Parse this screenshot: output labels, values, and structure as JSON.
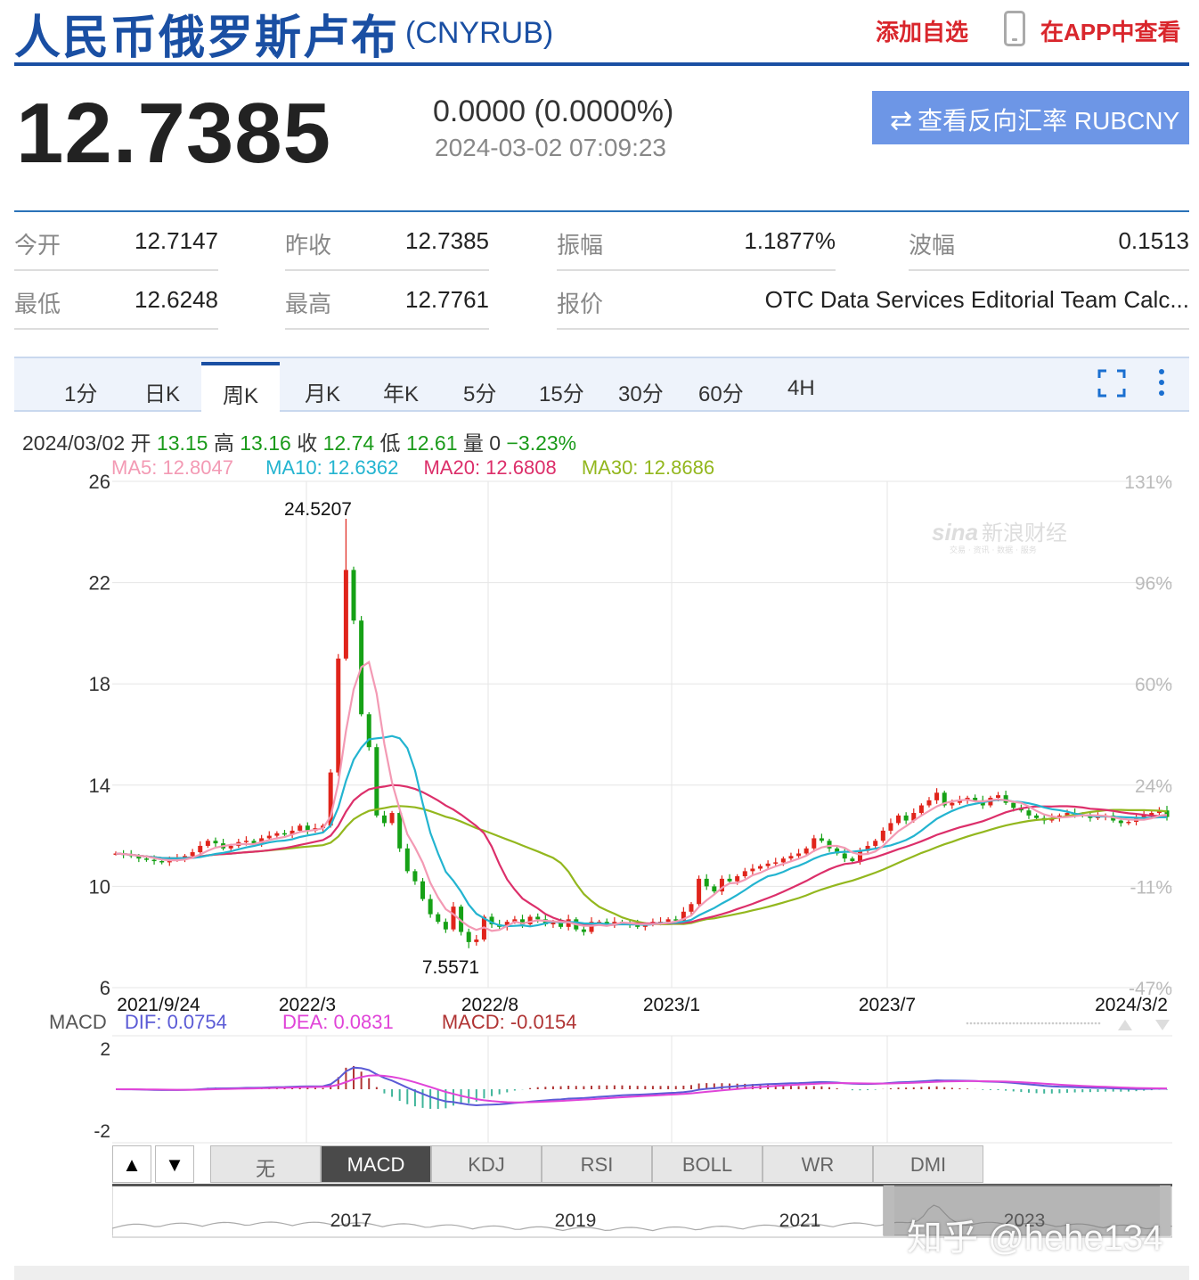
{
  "header": {
    "title": "人民币俄罗斯卢布",
    "code": "(CNYRUB)",
    "add_watchlist": "添加自选",
    "view_in_app": "在APP中查看"
  },
  "quote": {
    "price": "12.7385",
    "change": "0.0000 (0.0000%)",
    "timestamp": "2024-03-02 07:09:23",
    "reverse_icon": "⇄",
    "reverse_button": "查看反向汇率 RUBCNY"
  },
  "stats": [
    {
      "label": "今开",
      "value": "12.7147"
    },
    {
      "label": "昨收",
      "value": "12.7385"
    },
    {
      "label": "振幅",
      "value": "1.1877%"
    },
    {
      "label": "波幅",
      "value": "0.1513"
    },
    {
      "label": "最低",
      "value": "12.6248"
    },
    {
      "label": "最高",
      "value": "12.7761"
    },
    {
      "label": "报价",
      "value": "OTC Data Services Editorial Team Calc..."
    }
  ],
  "tabs": [
    "1分",
    "日K",
    "周K",
    "月K",
    "年K",
    "5分",
    "15分",
    "30分",
    "60分",
    "4H"
  ],
  "active_tab": "周K",
  "ohlc": {
    "date": "2024/03/02",
    "open_label": "开",
    "open": "13.15",
    "high_label": "高",
    "high": "13.16",
    "close_label": "收",
    "close": "12.74",
    "low_label": "低",
    "low": "12.61",
    "vol_label": "量",
    "vol": "0",
    "pct": "−3.23%"
  },
  "ma": {
    "ma5": "MA5: 12.8047",
    "ma10": "MA10: 12.6362",
    "ma20": "MA20: 12.6808",
    "ma30": "MA30: 12.8686"
  },
  "macd": {
    "label": "MACD",
    "dif": "DIF: 0.0754",
    "dea": "DEA: 0.0831",
    "macd": "MACD: -0.0154"
  },
  "indicators": [
    "无",
    "MACD",
    "KDJ",
    "RSI",
    "BOLL",
    "WR",
    "DMI"
  ],
  "active_indicator": "MACD",
  "nav": {
    "up": "▲",
    "down": "▼"
  },
  "colors": {
    "up": "#e0241b",
    "down": "#16a116",
    "ma5": "#f39ab4",
    "ma10": "#23b4d0",
    "ma20": "#dc2f6a",
    "ma30": "#93b71e",
    "dif": "#5b5bd6",
    "dea": "#e044d8",
    "brand": "#1a4fa3"
  },
  "brand_watermark": {
    "logo": "sina",
    "name": "新浪财经",
    "sub": "交易 · 资讯 · 数据 · 服务"
  },
  "overlay_watermark": "知乎 @hehe134",
  "chart_data": {
    "type": "candlestick",
    "ylim": [
      6,
      26
    ],
    "yticks": [
      6,
      10,
      14,
      18,
      22,
      26
    ],
    "pct_ticks": [
      "131%",
      "96%",
      "60%",
      "24%",
      "-11%",
      "-47%"
    ],
    "x_labels": [
      "2021/9/24",
      "2022/3",
      "2022/8",
      "2023/1",
      "2023/7",
      "2024/3/2"
    ],
    "annotations": [
      {
        "text": "24.5207",
        "value": 24.5207
      },
      {
        "text": "7.5571",
        "value": 7.5571
      }
    ],
    "close": [
      11.3,
      11.25,
      11.2,
      11.1,
      11.05,
      11.0,
      10.95,
      11.05,
      11.1,
      11.2,
      11.35,
      11.6,
      11.8,
      11.7,
      11.5,
      11.6,
      11.75,
      11.8,
      11.7,
      11.9,
      12.0,
      12.1,
      12.05,
      12.2,
      12.4,
      12.2,
      12.3,
      12.4,
      14.5,
      19.0,
      22.5,
      20.5,
      16.8,
      15.5,
      12.8,
      12.5,
      12.9,
      11.5,
      10.6,
      10.2,
      9.5,
      8.9,
      8.6,
      8.3,
      9.2,
      8.2,
      7.8,
      7.9,
      8.8,
      8.5,
      8.4,
      8.6,
      8.7,
      8.5,
      8.8,
      8.7,
      8.5,
      8.6,
      8.4,
      8.7,
      8.3,
      8.2,
      8.6,
      8.6,
      8.5,
      8.6,
      8.55,
      8.5,
      8.4,
      8.5,
      8.6,
      8.6,
      8.7,
      8.65,
      9.0,
      9.3,
      10.3,
      10.0,
      9.8,
      10.3,
      10.2,
      10.4,
      10.6,
      10.7,
      10.8,
      10.9,
      10.95,
      11.1,
      11.2,
      11.3,
      11.5,
      11.9,
      11.8,
      11.5,
      11.3,
      11.1,
      11.0,
      11.4,
      11.6,
      11.8,
      12.2,
      12.5,
      12.8,
      12.6,
      12.9,
      13.2,
      13.4,
      13.7,
      13.2,
      13.3,
      13.4,
      13.5,
      13.4,
      13.2,
      13.5,
      13.6,
      13.3,
      13.1,
      13.0,
      12.8,
      12.7,
      12.6,
      12.7,
      12.8,
      12.9,
      12.85,
      12.8,
      12.7,
      12.75,
      12.8,
      12.6,
      12.5,
      12.55,
      12.7,
      12.8,
      12.9,
      13.0,
      12.74
    ],
    "volume": [
      0
    ],
    "macd_ylim": [
      -2.6,
      2.6
    ],
    "macd_ticks": [
      2,
      -2
    ],
    "overview_years": [
      "2017",
      "2019",
      "2021",
      "2023"
    ]
  }
}
